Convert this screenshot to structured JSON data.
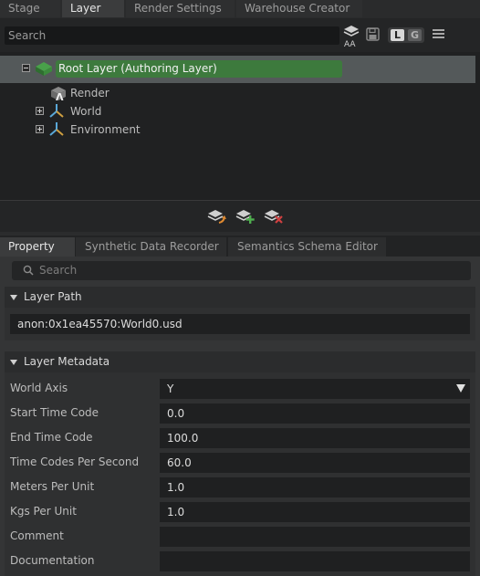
{
  "top_tabs": [
    {
      "label": "Stage",
      "active": false
    },
    {
      "label": "Layer",
      "active": true
    },
    {
      "label": "Render Settings",
      "active": false
    },
    {
      "label": "Warehouse Creator",
      "active": false
    }
  ],
  "toolbar": {
    "search_placeholder": "Search",
    "aa_label": "AA",
    "local_toggle": "L",
    "global_toggle": "G"
  },
  "tree": {
    "root_label": "Root Layer (Authoring Layer)",
    "items": [
      {
        "label": "Render",
        "icon": "render-layer-icon"
      },
      {
        "label": "World",
        "icon": "prim-axis-icon"
      },
      {
        "label": "Environment",
        "icon": "prim-axis-icon"
      }
    ]
  },
  "property_tabs": [
    {
      "label": "Property",
      "active": true
    },
    {
      "label": "Synthetic Data Recorder",
      "active": false
    },
    {
      "label": "Semantics Schema Editor",
      "active": false
    }
  ],
  "property": {
    "search_placeholder": "Search",
    "layer_path": {
      "title": "Layer Path",
      "value": "anon:0x1ea45570:World0.usd"
    },
    "metadata": {
      "title": "Layer Metadata",
      "world_axis": {
        "label": "World Axis",
        "value": "Y"
      },
      "start_time_code": {
        "label": "Start Time Code",
        "value": "0.0"
      },
      "end_time_code": {
        "label": "End Time Code",
        "value": "100.0"
      },
      "time_codes_per_second": {
        "label": "Time Codes Per Second",
        "value": "60.0"
      },
      "meters_per_unit": {
        "label": "Meters Per Unit",
        "value": "1.0"
      },
      "kgs_per_unit": {
        "label": "Kgs Per Unit",
        "value": "1.0"
      },
      "comment": {
        "label": "Comment",
        "value": ""
      },
      "documentation": {
        "label": "Documentation",
        "value": ""
      }
    }
  },
  "colors": {
    "root_highlight": "#3d7a3d",
    "selection_row": "#54595a",
    "background": "#1f2021"
  }
}
